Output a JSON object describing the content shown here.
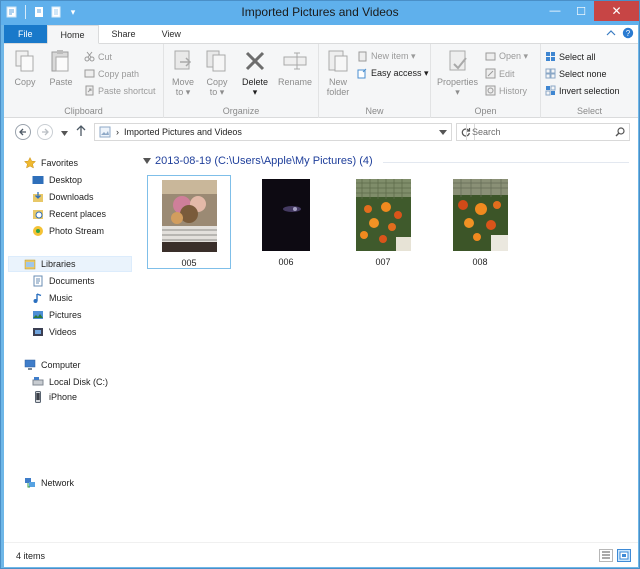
{
  "window": {
    "title": "Imported Pictures and Videos"
  },
  "quick_access": {
    "properties_icon": "properties-icon",
    "new_folder_icon": "new-folder-icon",
    "customize": "▾"
  },
  "window_controls": {
    "minimize": "—",
    "maximize": "☐",
    "close": "✕"
  },
  "tabs": [
    {
      "label": "File"
    },
    {
      "label": "Home"
    },
    {
      "label": "Share"
    },
    {
      "label": "View"
    }
  ],
  "ribbon": {
    "clipboard": {
      "label": "Clipboard",
      "copy": "Copy",
      "paste": "Paste",
      "cut": "Cut",
      "copy_path": "Copy path",
      "paste_shortcut": "Paste shortcut"
    },
    "organize": {
      "label": "Organize",
      "move_to_1": "Move",
      "move_to_2": "to ▾",
      "copy_to_1": "Copy",
      "copy_to_2": "to ▾",
      "delete": "Delete",
      "delete_arrow": "▾",
      "rename": "Rename"
    },
    "new": {
      "label": "New",
      "new_folder_1": "New",
      "new_folder_2": "folder",
      "new_item": "New item ▾",
      "easy_access": "Easy access ▾"
    },
    "open": {
      "label": "Open",
      "properties": "Properties",
      "properties_arrow": "▾",
      "open": "Open ▾",
      "edit": "Edit",
      "history": "History"
    },
    "select": {
      "label": "Select",
      "select_all": "Select all",
      "select_none": "Select none",
      "invert_selection": "Invert selection"
    }
  },
  "address_bar": {
    "path": "Imported Pictures and Videos",
    "separator": "›",
    "search_placeholder": "Search"
  },
  "nav_pane": {
    "favorites": {
      "label": "Favorites"
    },
    "favorites_items": [
      {
        "label": "Desktop"
      },
      {
        "label": "Downloads"
      },
      {
        "label": "Recent places"
      },
      {
        "label": "Photo Stream"
      }
    ],
    "libraries": {
      "label": "Libraries"
    },
    "libraries_items": [
      {
        "label": "Documents"
      },
      {
        "label": "Music"
      },
      {
        "label": "Pictures"
      },
      {
        "label": "Videos"
      }
    ],
    "computer": {
      "label": "Computer"
    },
    "computer_items": [
      {
        "label": "Local Disk (C:)"
      },
      {
        "label": "iPhone"
      }
    ],
    "network": {
      "label": "Network"
    }
  },
  "content": {
    "group_header": "2013-08-19 (C:\\Users\\Apple\\My Pictures) (4)",
    "files": [
      {
        "name": "005"
      },
      {
        "name": "006"
      },
      {
        "name": "007"
      },
      {
        "name": "008"
      }
    ]
  },
  "status_bar": {
    "item_count": "4 items"
  },
  "colors": {
    "titlebar": "#5fb0ec",
    "file_tab": "#1979ca",
    "accent_text": "#1f3f9b",
    "selection": "#cce8ff"
  }
}
